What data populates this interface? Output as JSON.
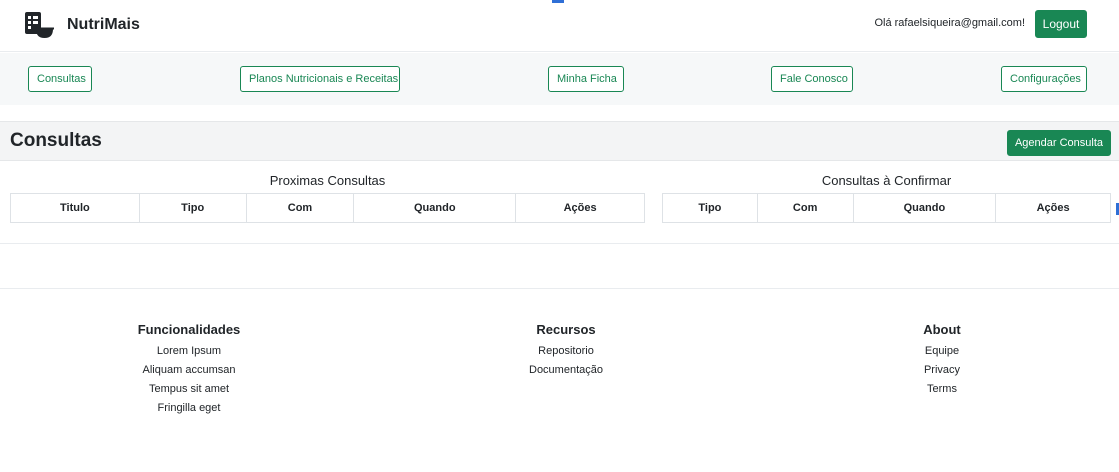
{
  "header": {
    "brand_name": "NutriMais",
    "greeting": "Olá rafaelsiqueira@gmail.com!",
    "logout_label": "Logout"
  },
  "nav": {
    "items": [
      {
        "label": "Consultas"
      },
      {
        "label": "Planos Nutricionais e Receitas"
      },
      {
        "label": "Minha Ficha"
      },
      {
        "label": "Fale Conosco"
      },
      {
        "label": "Configurações"
      }
    ]
  },
  "main": {
    "title": "Consultas",
    "schedule_button": "Agendar Consulta",
    "upcoming": {
      "caption": "Proximas Consultas",
      "columns": [
        "Titulo",
        "Tipo",
        "Com",
        "Quando",
        "Ações"
      ]
    },
    "pending": {
      "caption": "Consultas à Confirmar",
      "columns": [
        "Tipo",
        "Com",
        "Quando",
        "Ações"
      ]
    }
  },
  "footer": {
    "columns": [
      {
        "heading": "Funcionalidades",
        "links": [
          "Lorem Ipsum",
          "Aliquam accumsan",
          "Tempus sit amet",
          "Fringilla eget"
        ]
      },
      {
        "heading": "Recursos",
        "links": [
          "Repositorio",
          "Documentação"
        ]
      },
      {
        "heading": "About",
        "links": [
          "Equipe",
          "Privacy",
          "Terms"
        ]
      }
    ]
  },
  "colors": {
    "primary": "#198754",
    "nav_background": "#f6f8f9",
    "section_background": "#f3f4f5"
  }
}
